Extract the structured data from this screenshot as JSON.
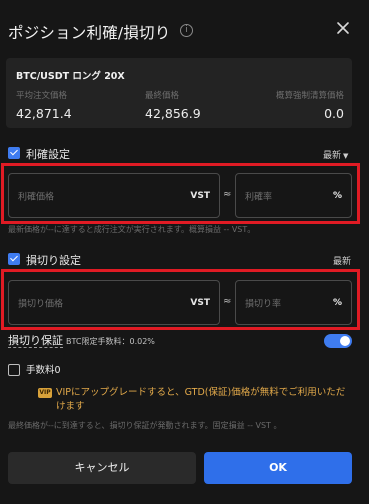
{
  "header": {
    "title": "ポジション利確/損切り",
    "info_icon": "i"
  },
  "position": {
    "title": "BTC/USDT ロング 20X",
    "avg_price_label": "平均注文価格",
    "avg_price_value": "42,871.4",
    "last_price_label": "最終価格",
    "last_price_value": "42,856.9",
    "liq_price_label": "概算強制清算価格",
    "liq_price_value": "0.0"
  },
  "take_profit": {
    "label": "利確設定",
    "price_type": "最新",
    "price_placeholder": "利確価格",
    "price_unit": "VST",
    "rate_placeholder": "利確率",
    "rate_unit": "%",
    "approx": "≈",
    "hint": "最新価格が--に達すると成行注文が実行されます。概算損益 -- VST。"
  },
  "stop_loss": {
    "label": "損切り設定",
    "price_type": "最新",
    "price_placeholder": "損切り価格",
    "price_unit": "VST",
    "rate_placeholder": "損切り率",
    "rate_unit": "%",
    "approx": "≈"
  },
  "guarantee": {
    "label": "損切り保証",
    "fee_text": "BTC限定手数料：0.02%",
    "enabled": true
  },
  "fee_zero": {
    "label": "手数料0",
    "checked": false,
    "vip_badge": "VIP",
    "vip_text": "VIPにアップグレードすると、GTD(保証)価格が無料でご利用いただけます"
  },
  "footer_hint": "最終価格が--に到達すると、損切り保証が発動されます。固定損益 -- VST 。",
  "buttons": {
    "cancel": "キャンセル",
    "ok": "OK"
  },
  "colors": {
    "accent": "#3f7cf0",
    "highlight_frame": "#e01b24",
    "vip": "#e2a94a"
  }
}
